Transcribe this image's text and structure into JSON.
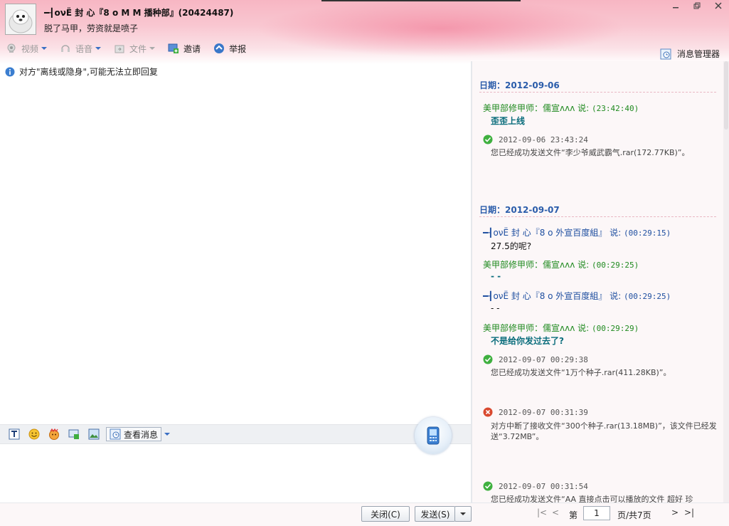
{
  "contact": {
    "name": "━┨oνЁ 封  心『8 o M M 播种部』(20424487)",
    "signature": "脱了马甲，劳资就是喷子"
  },
  "toolbar": {
    "video": "视频",
    "voice": "语音",
    "file": "文件",
    "invite": "邀请",
    "report": "举报"
  },
  "message_manager": "消息管理器",
  "notice": "对方\"离线或隐身\",可能无法立即回复",
  "input_toolbar": {
    "view_messages": "查看消息"
  },
  "history": {
    "day1": {
      "date": "日期：2012-09-06",
      "m1_sender": "美甲部修甲师：儒宣ʌʌʌ 说: ",
      "m1_time": "(23:42:40)",
      "m1_text": "歪歪上线",
      "s1_time": "2012-09-06 23:43:24",
      "s1_text": "您已经成功发送文件“李少爷威武霸气.rar(172.77KB)”。"
    },
    "day2": {
      "date": "日期：2012-09-07",
      "m1_sender": "━┨oνЁ 封  心『8 o 外宣百度組』 说: ",
      "m1_time": "(00:29:15)",
      "m1_text": "27.5的呢?",
      "m2_sender": "美甲部修甲师：儒宣ʌʌʌ 说: ",
      "m2_time": "(00:29:25)",
      "m2_text": "- -",
      "m3_sender": "━┨oνЁ 封  心『8 o 外宣百度組』 说: ",
      "m3_time": "(00:29:25)",
      "m3_text": "- -",
      "m4_sender": "美甲部修甲师：儒宣ʌʌʌ 说: ",
      "m4_time": "(00:29:29)",
      "m4_text": "不是给你发过去了?",
      "s1_time": "2012-09-07 00:29:38",
      "s1_text": "您已经成功发送文件“1万个种子.rar(411.28KB)”。",
      "s2_time": "2012-09-07 00:31:39",
      "s2_text": "对方中断了接收文件“300个种子.rar(13.18MB)”，该文件已经发送“3.72MB”。",
      "s3_time": "2012-09-07 00:31:54",
      "s3_text": "您已经成功发送文件“AA 直接点击可以播放的文件 超好 珍"
    }
  },
  "bottom": {
    "close": "关闭(C)",
    "send": "发送(S)",
    "page_label": "第",
    "page_value": "1",
    "page_total": "页/共7页"
  },
  "colors": {
    "header_pink": "#f7b6c3",
    "date_blue": "#2a5caa",
    "sender_green": "#1f8a1f",
    "sender_blue": "#1f4fa0",
    "content_teal": "#0a6d7c"
  }
}
